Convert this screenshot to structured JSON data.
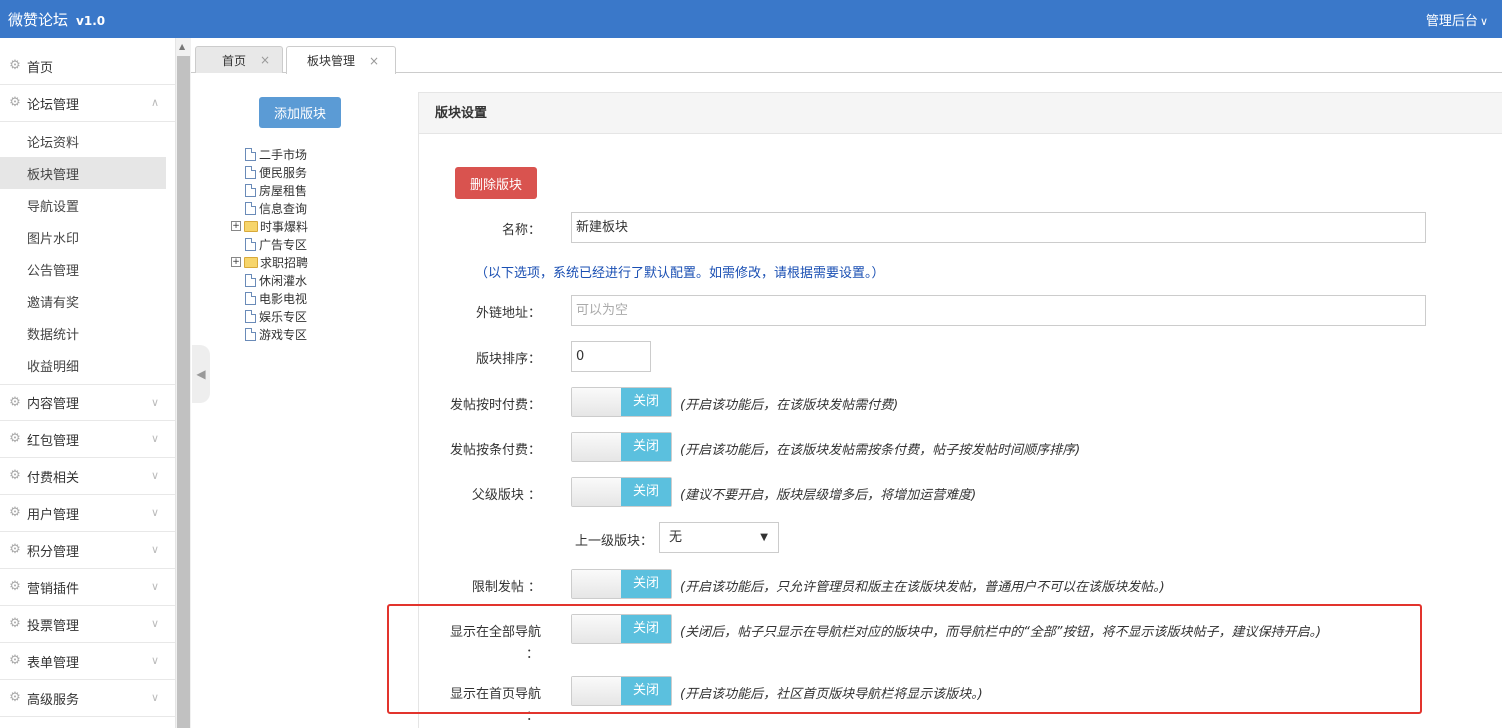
{
  "topbar": {
    "brand": "微赞论坛",
    "version": "v1.0",
    "admin": "管理后台"
  },
  "sidebar": {
    "home": "首页",
    "forum": "论坛管理",
    "forum_sub": [
      "论坛资料",
      "板块管理",
      "导航设置",
      "图片水印",
      "公告管理",
      "邀请有奖",
      "数据统计",
      "收益明细"
    ],
    "groups": [
      "内容管理",
      "红包管理",
      "付费相关",
      "用户管理",
      "积分管理",
      "营销插件",
      "投票管理",
      "表单管理",
      "高级服务"
    ]
  },
  "tabs": [
    {
      "label": "首页",
      "close": "×"
    },
    {
      "label": "板块管理",
      "close": "×"
    }
  ],
  "tree": {
    "add_label": "添加版块",
    "nodes": [
      "二手市场",
      "便民服务",
      "房屋租售",
      "信息查询",
      "时事爆料",
      "广告专区",
      "求职招聘",
      "休闲灌水",
      "电影电视",
      "娱乐专区",
      "游戏专区"
    ]
  },
  "settings": {
    "title": "版块设置",
    "delete_label": "删除版块",
    "name_label": "名称：",
    "name_value": "新建板块",
    "hint": "（以下选项，系统已经进行了默认配置。如需修改，请根据需要设置。）",
    "link_label": "外链地址：",
    "link_placeholder": "可以为空",
    "order_label": "版块排序：",
    "order_value": "0",
    "toggle_off": "关闭",
    "time_pay_label": "发帖按时付费：",
    "time_pay_note": "(开启该功能后，在该版块发帖需付费)",
    "count_pay_label": "发帖按条付费：",
    "count_pay_note": "(开启该功能后，在该版块发帖需按条付费，帖子按发帖时间顺序排序)",
    "parent_label": "父级版块 ：",
    "parent_note": "(建议不要开启，版块层级增多后，将增加运营难度)",
    "upper_label": "上一级版块：",
    "upper_value": "无",
    "limit_label": "限制发帖 ：",
    "limit_note": "(开启该功能后，只允许管理员和版主在该版块发帖，普通用户不可以在该版块发帖。)",
    "show_all_label": "显示在全部导航",
    "show_all_label2": "：",
    "show_all_note": "(关闭后，帖子只显示在导航栏对应的版块中，而导航栏中的“全部”按钮，将不显示该版块帖子，建议保持开启。)",
    "show_home_label": "显示在首页导航",
    "show_home_label2": "：",
    "show_home_note": "(开启该功能后，社区首页版块导航栏将显示该版块。)"
  },
  "colors": {
    "topbar": "#3a78c9",
    "toggle_off": "#5bc0de",
    "delete": "#d9534f",
    "add": "#5b9bd5",
    "hint": "#1a4fb3",
    "highlight": "#e2342d"
  }
}
